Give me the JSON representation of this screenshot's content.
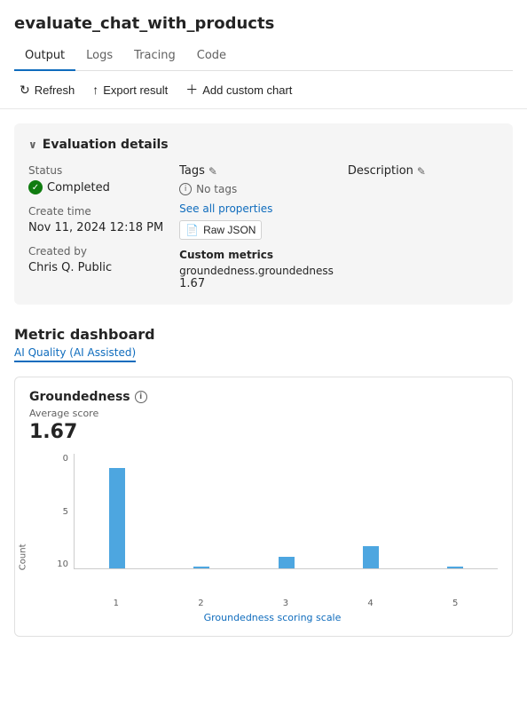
{
  "page": {
    "title": "evaluate_chat_with_products",
    "tabs": [
      {
        "label": "Output",
        "active": true
      },
      {
        "label": "Logs",
        "active": false
      },
      {
        "label": "Tracing",
        "active": false
      },
      {
        "label": "Code",
        "active": false
      }
    ]
  },
  "toolbar": {
    "refresh_label": "Refresh",
    "export_label": "Export result",
    "add_chart_label": "Add custom chart"
  },
  "evaluation": {
    "section_title": "Evaluation details",
    "status_label": "Status",
    "status_value": "Completed",
    "create_time_label": "Create time",
    "create_time_value": "Nov 11, 2024 12:18 PM",
    "created_by_label": "Created by",
    "created_by_value": "Chris Q. Public",
    "tags_label": "Tags",
    "no_tags_text": "No tags",
    "see_all_properties": "See all properties",
    "raw_json_label": "Raw JSON",
    "custom_metrics_label": "Custom metrics",
    "metric_path": "groundedness.groundedness",
    "metric_value": "1.67",
    "description_label": "Description"
  },
  "dashboard": {
    "title": "Metric dashboard",
    "active_tab": "AI Quality (AI Assisted)"
  },
  "groundedness_chart": {
    "title": "Groundedness",
    "avg_score_label": "Average score",
    "avg_score_value": "1.67",
    "y_labels": [
      "10",
      "5",
      "0"
    ],
    "x_labels": [
      "1",
      "2",
      "3",
      "4",
      "5"
    ],
    "x_axis_title": "Groundedness scoring scale",
    "y_axis_title": "Count",
    "bars": [
      {
        "label": "1",
        "value": 9,
        "max": 10
      },
      {
        "label": "2",
        "value": 0,
        "max": 10
      },
      {
        "label": "3",
        "value": 1,
        "max": 10
      },
      {
        "label": "4",
        "value": 2,
        "max": 10
      },
      {
        "label": "5",
        "value": 0,
        "max": 10
      }
    ]
  }
}
